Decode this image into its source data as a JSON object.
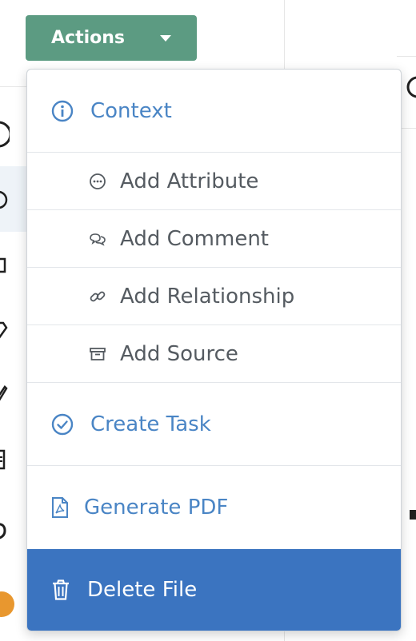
{
  "actions_button": {
    "label": "Actions"
  },
  "menu": {
    "context": "Context",
    "add_attribute": "Add Attribute",
    "add_comment": "Add Comment",
    "add_relationship": "Add Relationship",
    "add_source": "Add Source",
    "create_task": "Create Task",
    "generate_pdf": "Generate PDF",
    "delete_file": "Delete File"
  },
  "colors": {
    "actions_bg": "#5c9b82",
    "link_blue": "#4a85c5",
    "danger_bg": "#3b74c0"
  }
}
